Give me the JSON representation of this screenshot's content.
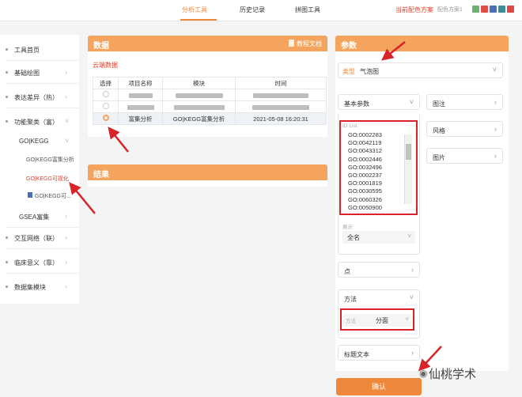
{
  "topbar": {
    "tabs": [
      "分析工具",
      "历史记录",
      "拼图工具"
    ],
    "scheme_label": "当前配色方案",
    "scheme_current": "配色方案1",
    "swatches": [
      "#6bb36f",
      "#e34b4b",
      "#4a6fb5",
      "#3f8c95",
      "#d94a4a"
    ]
  },
  "sidebar": {
    "items": [
      "工具首页",
      "基础绘图",
      "表达差异（热）",
      "功能聚类（富）",
      "GO|KEGG",
      "GO|KEGG富集分析",
      "GO|KEGG可视化",
      "GO|KEGG可...",
      "GSEA富集",
      "交互网络（联）",
      "临床意义（靠）",
      "数据集模块"
    ]
  },
  "data_panel": {
    "title": "数据",
    "doc_link": "教程文档",
    "cloud_link": "云端数据",
    "columns": [
      "选择",
      "项目名称",
      "模块",
      "时间"
    ],
    "selected_row": {
      "project": "富集分析",
      "module": "GO|KEGG富集分析",
      "time": "2021-05-08 16:20:31"
    }
  },
  "result_panel": {
    "title": "结果"
  },
  "params": {
    "title": "参数",
    "type_label": "类型",
    "type_value": "气泡图",
    "basic_params": "基本参数",
    "id_list_label": "ID List",
    "id_list": [
      "GO:0002283",
      "GO:0042119",
      "GO:0043312",
      "GO:0002446",
      "GO:0032496",
      "GO:0002237",
      "GO:0001819",
      "GO:0030595",
      "GO:0060326",
      "GO:0050900"
    ],
    "display_label": "展示",
    "display_value": "全名",
    "point_label": "点",
    "method_section": "方法",
    "method_label": "方法",
    "method_value": "分面",
    "title_text": "标题文本",
    "legend": "图注",
    "style": "风格",
    "image": "图片",
    "confirm": "确认"
  },
  "watermark": "仙桃学术"
}
